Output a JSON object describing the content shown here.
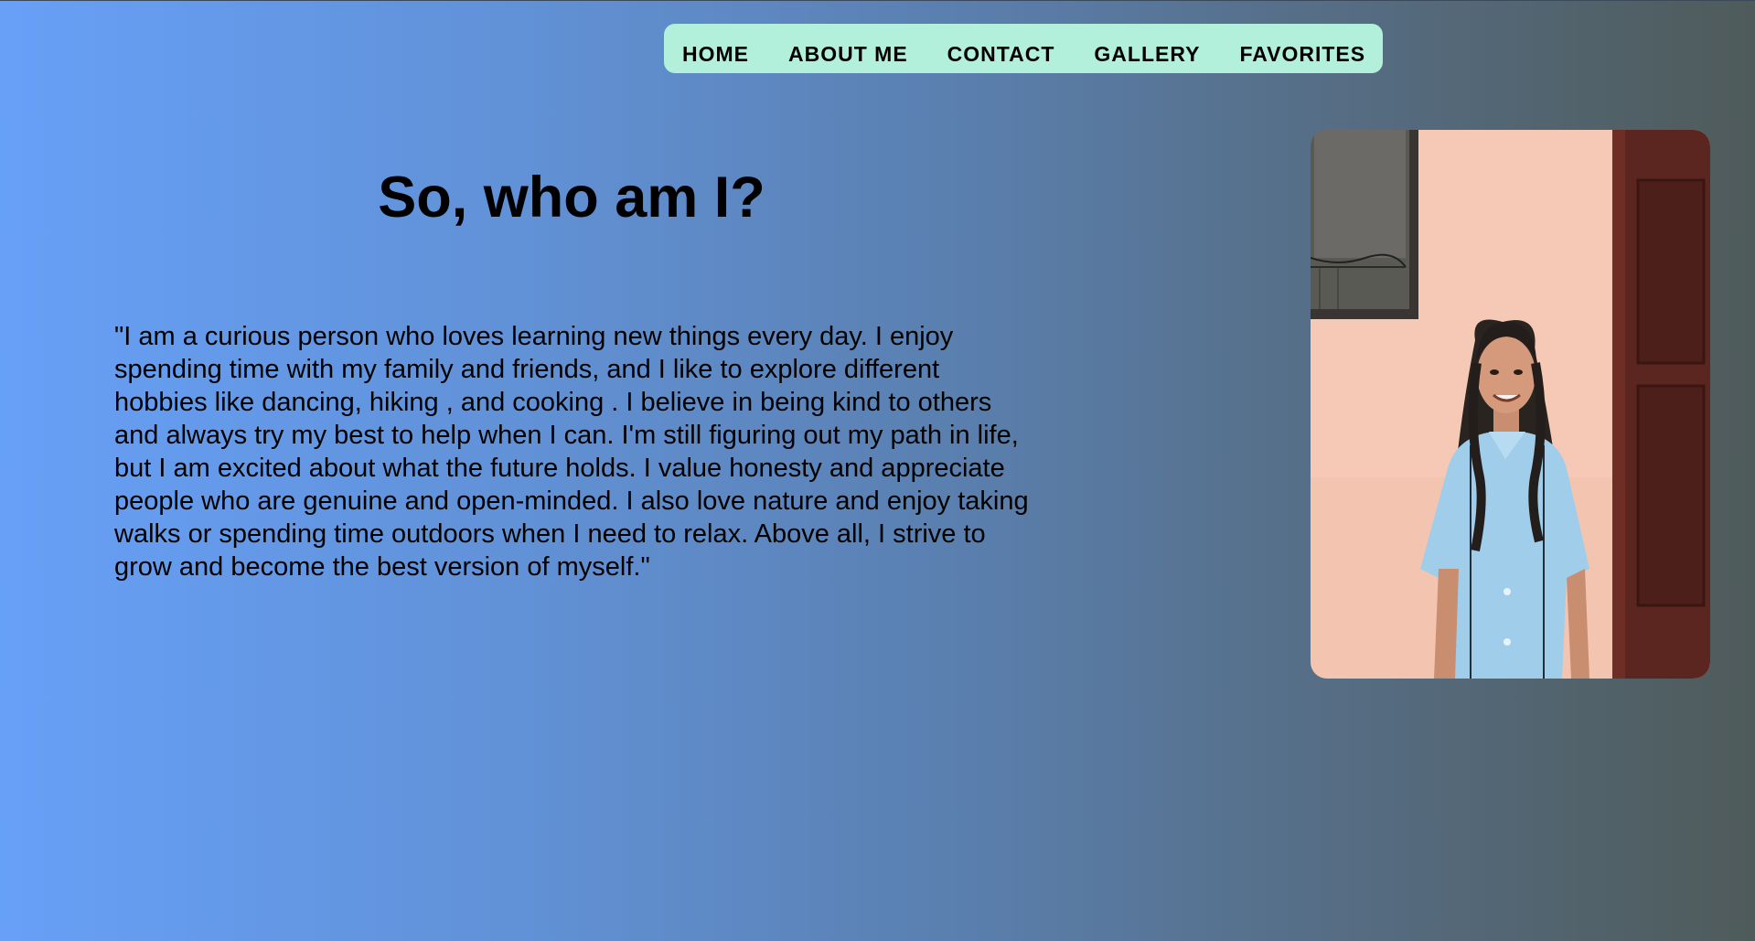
{
  "nav": {
    "items": [
      {
        "label": "HOME"
      },
      {
        "label": "ABOUT ME"
      },
      {
        "label": "CONTACT"
      },
      {
        "label": "GALLERY"
      },
      {
        "label": "FAVORITES"
      }
    ]
  },
  "main": {
    "heading": "So, who am I?",
    "bio": "\"I am a curious person who loves learning new things every day. I enjoy spending time with my family and friends, and I like to explore different hobbies like dancing, hiking , and cooking . I believe in being kind to others and always try my best to help when I can. I'm still figuring out my path in life, but I am excited about what the future holds. I value honesty and appreciate people who are genuine and open-minded. I also love nature and enjoy taking walks or spending time outdoors when I need to relax. Above all, I strive to grow and become the best version of myself.\""
  },
  "colors": {
    "nav_background": "#b2f0dc",
    "gradient_left": "#67a0f7",
    "gradient_right": "#4f5b5a"
  }
}
